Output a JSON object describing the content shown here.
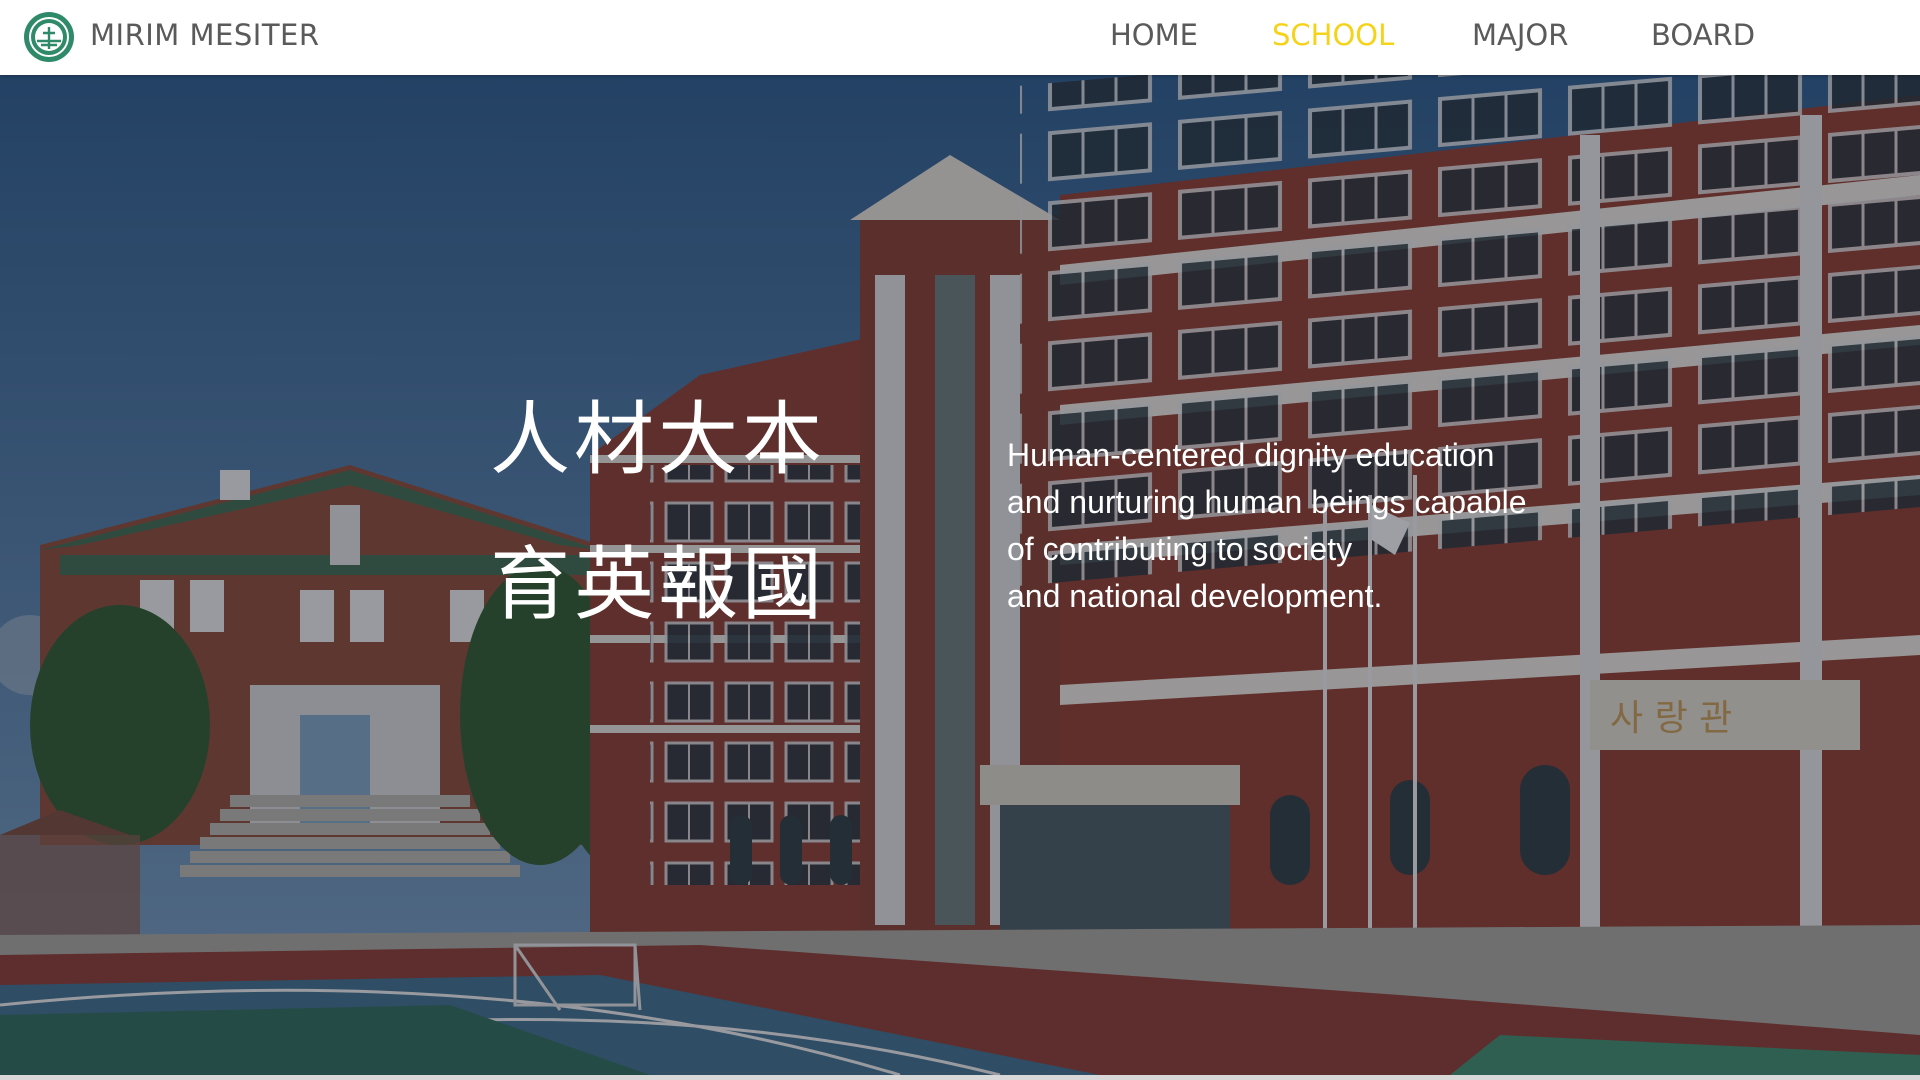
{
  "header": {
    "brand": "MIRIM MESITER",
    "logo_icon": "school-emblem-icon",
    "nav": [
      {
        "label": "HOME",
        "active": false
      },
      {
        "label": "SCHOOL",
        "active": true
      },
      {
        "label": "MAJOR",
        "active": false
      },
      {
        "label": "BOARD",
        "active": false
      }
    ]
  },
  "hero": {
    "motto_line1": "人材大本",
    "motto_line2": "育英報國",
    "mission_lines": [
      "Human-centered dignity education",
      "and nurturing human beings capable",
      "of contributing to society",
      "and national development."
    ],
    "sign_text": "사 랑 관"
  },
  "colors": {
    "active_nav": "#f5d31a",
    "nav_text": "#5a5a5a",
    "brick": "#8a3a2c",
    "sky": "#3f6d9a"
  }
}
